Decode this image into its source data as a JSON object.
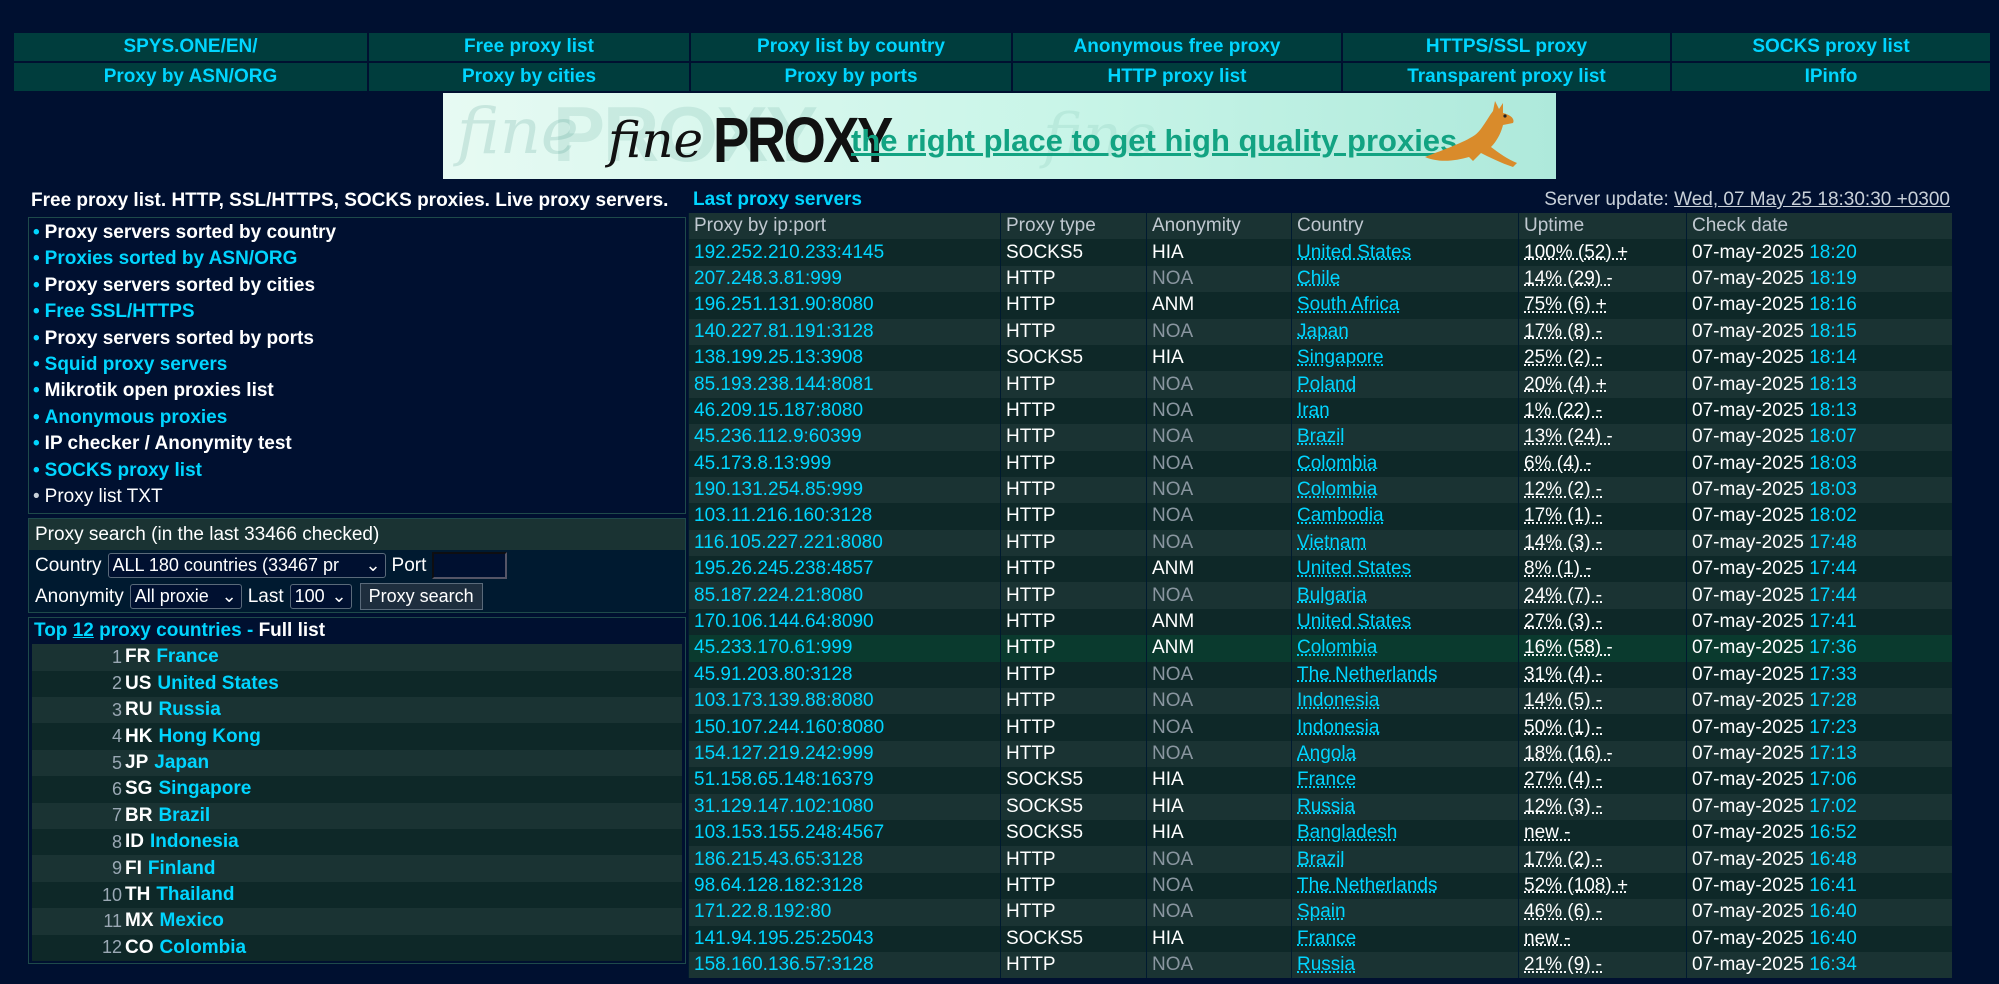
{
  "nav": {
    "row1": [
      "SPYS.ONE/EN/",
      "Free proxy list",
      "Proxy list by country",
      "Anonymous free proxy",
      "HTTPS/SSL proxy",
      "SOCKS proxy list"
    ],
    "row2": [
      "Proxy by ASN/ORG",
      "Proxy by cities",
      "Proxy by ports",
      "HTTP proxy list",
      "Transparent proxy list",
      "IPinfo"
    ]
  },
  "banner": {
    "brand_fine": "fine",
    "brand_proxy": "PROXY",
    "tagline": "the right place to get high quality proxies"
  },
  "left": {
    "heading": "Free proxy list. HTTP, SSL/HTTPS, SOCKS proxies. Live proxy servers.",
    "bullet": "•",
    "menu": [
      {
        "label": "Proxy servers sorted by country",
        "style": "white"
      },
      {
        "label": "Proxies sorted by ASN/ORG",
        "style": "cyan"
      },
      {
        "label": "Proxy servers sorted by cities",
        "style": "white"
      },
      {
        "label": "Free SSL/HTTPS",
        "style": "cyan"
      },
      {
        "label": "Proxy servers sorted by ports",
        "style": "white"
      },
      {
        "label": "Squid proxy servers",
        "style": "cyan"
      },
      {
        "label": "Mikrotik open proxies list",
        "style": "white"
      },
      {
        "label": "Anonymous proxies",
        "style": "cyan"
      },
      {
        "label": "IP checker / Anonymity test",
        "style": "white"
      },
      {
        "label": "SOCKS proxy list",
        "style": "cyan"
      },
      {
        "label": "Proxy list TXT",
        "style": "normal"
      }
    ],
    "search": {
      "title": "Proxy search (in the last 33466 checked)",
      "country_label": "Country",
      "country_value": "ALL 180 countries (33467 pr",
      "port_label": "Port",
      "anonymity_label": "Anonymity",
      "anonymity_value": "All proxie",
      "last_label": "Last",
      "last_value": "100",
      "button": "Proxy search"
    },
    "top": {
      "prefix": "Top",
      "count": "12",
      "suffix": "proxy countries -",
      "full_list": "Full list",
      "countries": [
        {
          "n": "1",
          "code": "FR",
          "name": "France"
        },
        {
          "n": "2",
          "code": "US",
          "name": "United States"
        },
        {
          "n": "3",
          "code": "RU",
          "name": "Russia"
        },
        {
          "n": "4",
          "code": "HK",
          "name": "Hong Kong"
        },
        {
          "n": "5",
          "code": "JP",
          "name": "Japan"
        },
        {
          "n": "6",
          "code": "SG",
          "name": "Singapore"
        },
        {
          "n": "7",
          "code": "BR",
          "name": "Brazil"
        },
        {
          "n": "8",
          "code": "ID",
          "name": "Indonesia"
        },
        {
          "n": "9",
          "code": "FI",
          "name": "Finland"
        },
        {
          "n": "10",
          "code": "TH",
          "name": "Thailand"
        },
        {
          "n": "11",
          "code": "MX",
          "name": "Mexico"
        },
        {
          "n": "12",
          "code": "CO",
          "name": "Colombia"
        }
      ]
    }
  },
  "right": {
    "title": "Last proxy servers",
    "update_label": "Server update:",
    "update_value": "Wed, 07 May 25 18:30:30 +0300",
    "columns": [
      "Proxy by ip:port",
      "Proxy type",
      "Anonymity",
      "Country",
      "Uptime",
      "Check date"
    ],
    "rows": [
      {
        "ip": "192.252.210.233:4145",
        "type": "SOCKS5",
        "anon": "HIA",
        "country": "United States",
        "uptime": "100% (52) +",
        "date": "07-may-2025",
        "time": "18:20"
      },
      {
        "ip": "207.248.3.81:999",
        "type": "HTTP",
        "anon": "NOA",
        "country": "Chile",
        "uptime": "14% (29) -",
        "date": "07-may-2025",
        "time": "18:19"
      },
      {
        "ip": "196.251.131.90:8080",
        "type": "HTTP",
        "anon": "ANM",
        "country": "South Africa",
        "uptime": "75% (6) +",
        "date": "07-may-2025",
        "time": "18:16"
      },
      {
        "ip": "140.227.81.191:3128",
        "type": "HTTP",
        "anon": "NOA",
        "country": "Japan",
        "uptime": "17% (8) -",
        "date": "07-may-2025",
        "time": "18:15"
      },
      {
        "ip": "138.199.25.13:3908",
        "type": "SOCKS5",
        "anon": "HIA",
        "country": "Singapore",
        "uptime": "25% (2) -",
        "date": "07-may-2025",
        "time": "18:14"
      },
      {
        "ip": "85.193.238.144:8081",
        "type": "HTTP",
        "anon": "NOA",
        "country": "Poland",
        "uptime": "20% (4) +",
        "date": "07-may-2025",
        "time": "18:13"
      },
      {
        "ip": "46.209.15.187:8080",
        "type": "HTTP",
        "anon": "NOA",
        "country": "Iran",
        "uptime": "1% (22) -",
        "date": "07-may-2025",
        "time": "18:13"
      },
      {
        "ip": "45.236.112.9:60399",
        "type": "HTTP",
        "anon": "NOA",
        "country": "Brazil",
        "uptime": "13% (24) -",
        "date": "07-may-2025",
        "time": "18:07"
      },
      {
        "ip": "45.173.8.13:999",
        "type": "HTTP",
        "anon": "NOA",
        "country": "Colombia",
        "uptime": "6% (4) -",
        "date": "07-may-2025",
        "time": "18:03"
      },
      {
        "ip": "190.131.254.85:999",
        "type": "HTTP",
        "anon": "NOA",
        "country": "Colombia",
        "uptime": "12% (2) -",
        "date": "07-may-2025",
        "time": "18:03"
      },
      {
        "ip": "103.11.216.160:3128",
        "type": "HTTP",
        "anon": "NOA",
        "country": "Cambodia",
        "uptime": "17% (1) -",
        "date": "07-may-2025",
        "time": "18:02"
      },
      {
        "ip": "116.105.227.221:8080",
        "type": "HTTP",
        "anon": "NOA",
        "country": "Vietnam",
        "uptime": "14% (3) -",
        "date": "07-may-2025",
        "time": "17:48"
      },
      {
        "ip": "195.26.245.238:4857",
        "type": "HTTP",
        "anon": "ANM",
        "country": "United States",
        "uptime": "8% (1) -",
        "date": "07-may-2025",
        "time": "17:44"
      },
      {
        "ip": "85.187.224.21:8080",
        "type": "HTTP",
        "anon": "NOA",
        "country": "Bulgaria",
        "uptime": "24% (7) -",
        "date": "07-may-2025",
        "time": "17:44"
      },
      {
        "ip": "170.106.144.64:8090",
        "type": "HTTP",
        "anon": "ANM",
        "country": "United States",
        "uptime": "27% (3) -",
        "date": "07-may-2025",
        "time": "17:41"
      },
      {
        "ip": "45.233.170.61:999",
        "type": "HTTP",
        "anon": "ANM",
        "country": "Colombia",
        "uptime": "16% (58) -",
        "date": "07-may-2025",
        "time": "17:36"
      },
      {
        "ip": "45.91.203.80:3128",
        "type": "HTTP",
        "anon": "NOA",
        "country": "The Netherlands",
        "uptime": "31% (4) -",
        "date": "07-may-2025",
        "time": "17:33"
      },
      {
        "ip": "103.173.139.88:8080",
        "type": "HTTP",
        "anon": "NOA",
        "country": "Indonesia",
        "uptime": "14% (5) -",
        "date": "07-may-2025",
        "time": "17:28"
      },
      {
        "ip": "150.107.244.160:8080",
        "type": "HTTP",
        "anon": "NOA",
        "country": "Indonesia",
        "uptime": "50% (1) -",
        "date": "07-may-2025",
        "time": "17:23"
      },
      {
        "ip": "154.127.219.242:999",
        "type": "HTTP",
        "anon": "NOA",
        "country": "Angola",
        "uptime": "18% (16) -",
        "date": "07-may-2025",
        "time": "17:13"
      },
      {
        "ip": "51.158.65.148:16379",
        "type": "SOCKS5",
        "anon": "HIA",
        "country": "France",
        "uptime": "27% (4) -",
        "date": "07-may-2025",
        "time": "17:06"
      },
      {
        "ip": "31.129.147.102:1080",
        "type": "SOCKS5",
        "anon": "HIA",
        "country": "Russia",
        "uptime": "12% (3) -",
        "date": "07-may-2025",
        "time": "17:02"
      },
      {
        "ip": "103.153.155.248:4567",
        "type": "SOCKS5",
        "anon": "HIA",
        "country": "Bangladesh",
        "uptime": "new -",
        "date": "07-may-2025",
        "time": "16:52"
      },
      {
        "ip": "186.215.43.65:3128",
        "type": "HTTP",
        "anon": "NOA",
        "country": "Brazil",
        "uptime": "17% (2) -",
        "date": "07-may-2025",
        "time": "16:48"
      },
      {
        "ip": "98.64.128.182:3128",
        "type": "HTTP",
        "anon": "NOA",
        "country": "The Netherlands",
        "uptime": "52% (108) +",
        "date": "07-may-2025",
        "time": "16:41"
      },
      {
        "ip": "171.22.8.192:80",
        "type": "HTTP",
        "anon": "NOA",
        "country": "Spain",
        "uptime": "46% (6) -",
        "date": "07-may-2025",
        "time": "16:40"
      },
      {
        "ip": "141.94.195.25:25043",
        "type": "SOCKS5",
        "anon": "HIA",
        "country": "France",
        "uptime": "new -",
        "date": "07-may-2025",
        "time": "16:40"
      },
      {
        "ip": "158.160.136.57:3128",
        "type": "HTTP",
        "anon": "NOA",
        "country": "Russia",
        "uptime": "21% (9) -",
        "date": "07-may-2025",
        "time": "16:34"
      }
    ]
  }
}
